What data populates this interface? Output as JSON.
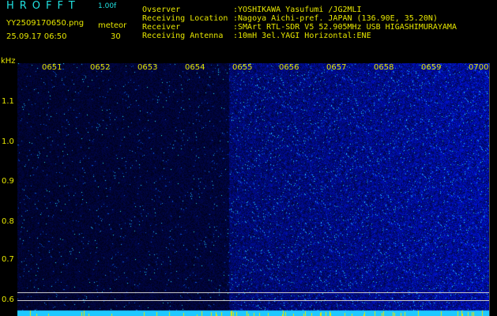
{
  "header": {
    "logo": "HROFFT",
    "version": "1.00f",
    "filename": "YY2509170650.png",
    "meteor_label": "meteor",
    "datetime": "25.09.17 06:50",
    "meteor_count": "30"
  },
  "info": [
    {
      "key": "Ovserver",
      "value": ":YOSHIKAWA Yasufumi /JG2MLI"
    },
    {
      "key": "Receiving Location",
      "value": ":Nagoya Aichi-pref. JAPAN (136.90E, 35.20N)"
    },
    {
      "key": "Receiver",
      "value": ":SMArt RTL-SDR V5 52.905MHz USB HIGASHIMURAYAMA"
    },
    {
      "key": "Receiving Antenna",
      "value": ":10mH 3el.YAGI Horizontal:ENE"
    }
  ],
  "axis": {
    "y_unit": "kHz",
    "y_ticks": [
      "1.1",
      "1.0",
      "0.9",
      "0.8",
      "0.7",
      "0.6"
    ],
    "x_ticks": [
      "0651",
      "0652",
      "0653",
      "0654",
      "0655",
      "0656",
      "0657",
      "0658",
      "0659",
      "0700"
    ]
  },
  "colors": {
    "label": "#e6e600",
    "logo": "#20e0e0",
    "background": "#000000",
    "spectrum_dark": "#00062a",
    "spectrum_bright": "#1a2bd0",
    "speckle": "#40c0ff"
  }
}
